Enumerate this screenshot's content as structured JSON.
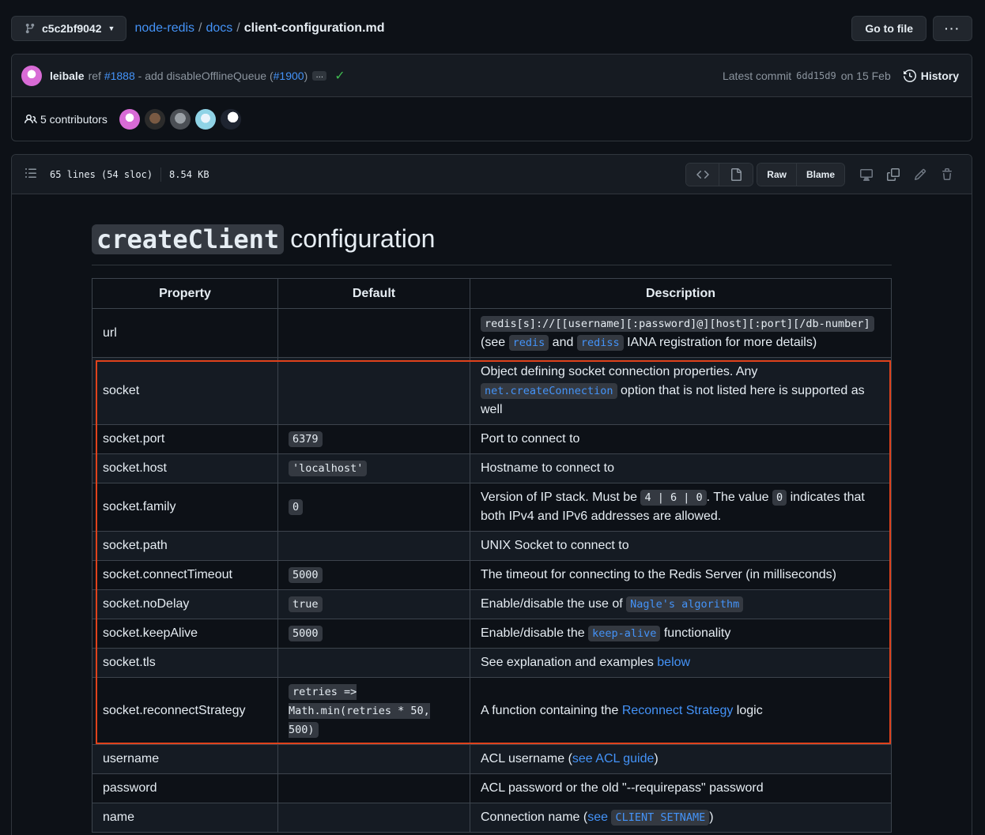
{
  "header": {
    "branch": "c5c2bf9042",
    "breadcrumb": [
      "node-redis",
      "docs"
    ],
    "file_name": "client-configuration.md",
    "go_to_file": "Go to file",
    "more": "···"
  },
  "commit": {
    "author": "leibale",
    "msg_prefix": "ref",
    "ref_link": "#1888",
    "msg_middle": "- add disableOfflineQueue (",
    "pr_link": "#1900",
    "msg_suffix": ")",
    "expand": "…",
    "latest_label": "Latest commit",
    "sha": "6dd15d9",
    "date": "on 15 Feb",
    "history": "History"
  },
  "contributors": {
    "label": "5 contributors"
  },
  "file": {
    "lines": "65 lines (54 sloc)",
    "size": "8.54 KB",
    "raw": "Raw",
    "blame": "Blame"
  },
  "doc": {
    "title_code": "createClient",
    "title_rest": "configuration",
    "headers": [
      "Property",
      "Default",
      "Description"
    ],
    "rows": {
      "url": {
        "prop": "url",
        "desc_code": "redis[s]://[[username][:password]@][host][:port][/db-number]",
        "desc_a": "(see",
        "link1": "redis",
        "desc_b": "and",
        "link2": "rediss",
        "desc_c": "IANA registration for more details)"
      },
      "socket": {
        "prop": "socket",
        "desc_a": "Object defining socket connection properties. Any",
        "link": "net.createConnection",
        "desc_b": "option that is not listed here is supported as well"
      },
      "port": {
        "prop": "socket.port",
        "default": "6379",
        "desc": "Port to connect to"
      },
      "host": {
        "prop": "socket.host",
        "default": "'localhost'",
        "desc": "Hostname to connect to"
      },
      "family": {
        "prop": "socket.family",
        "default": "0",
        "desc_a": "Version of IP stack. Must be",
        "code1": "4 | 6 | 0",
        "desc_b": ". The value",
        "code2": "0",
        "desc_c": "indicates that both IPv4 and IPv6 addresses are allowed."
      },
      "path": {
        "prop": "socket.path",
        "desc": "UNIX Socket to connect to"
      },
      "timeout": {
        "prop": "socket.connectTimeout",
        "default": "5000",
        "desc": "The timeout for connecting to the Redis Server (in milliseconds)"
      },
      "nodelay": {
        "prop": "socket.noDelay",
        "default": "true",
        "desc_a": "Enable/disable the use of",
        "link": "Nagle's algorithm"
      },
      "keepalive": {
        "prop": "socket.keepAlive",
        "default": "5000",
        "desc_a": "Enable/disable the",
        "link": "keep-alive",
        "desc_b": "functionality"
      },
      "tls": {
        "prop": "socket.tls",
        "desc_a": "See explanation and examples",
        "link": "below"
      },
      "reconnect": {
        "prop": "socket.reconnectStrategy",
        "default": "retries => Math.min(retries * 50, 500)",
        "desc_a": "A function containing the",
        "link": "Reconnect Strategy",
        "desc_b": "logic"
      },
      "username": {
        "prop": "username",
        "desc_a": "ACL username (",
        "link": "see ACL guide",
        "desc_b": ")"
      },
      "password": {
        "prop": "password",
        "desc": "ACL password or the old \"--requirepass\" password"
      },
      "name": {
        "prop": "name",
        "desc_a": "Connection name (",
        "link1": "see",
        "code": "CLIENT SETNAME",
        "desc_b": ")"
      }
    }
  }
}
